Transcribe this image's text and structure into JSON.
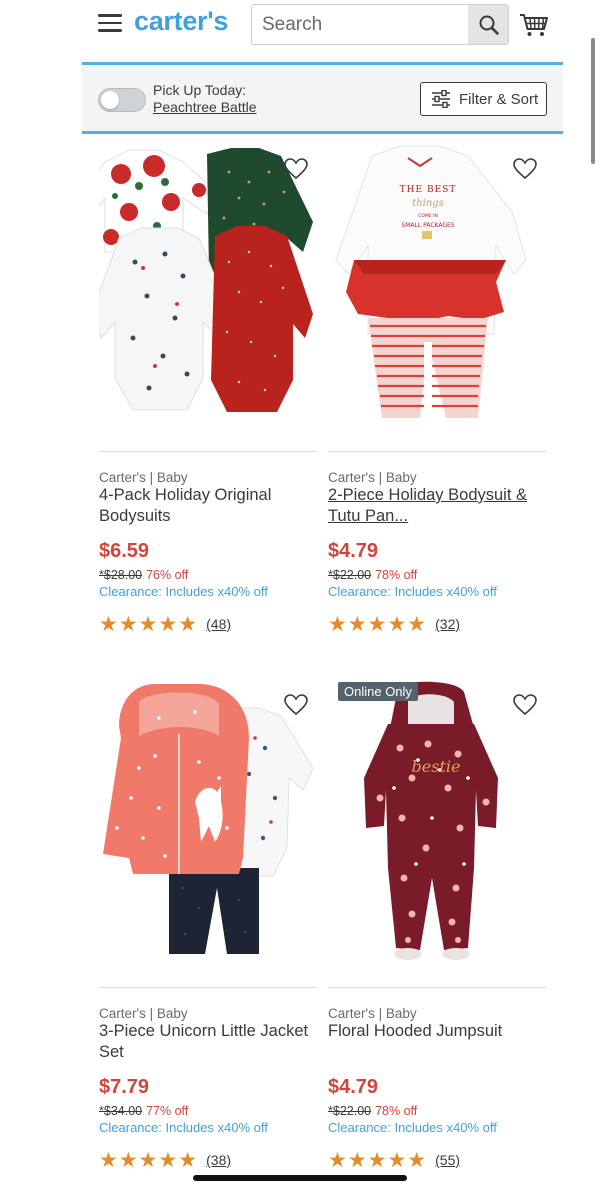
{
  "header": {
    "logo": "carter's",
    "search_placeholder": "Search"
  },
  "filter_bar": {
    "pickup_label": "Pick Up Today:",
    "pickup_store": "Peachtree Battle",
    "filter_label": "Filter & Sort"
  },
  "colors": {
    "brand_blue": "#3fa2dd",
    "sale_red": "#d2453b",
    "star_orange": "#e58b2c"
  },
  "products": [
    {
      "brand": "Carter's | Baby",
      "name": "4-Pack Holiday Original Bodysuits",
      "price": "$6.59",
      "was": "*$28.00",
      "off": "76% off",
      "clearance": "Clearance: Includes x40% off",
      "stars": "★★★★★",
      "rating": 5,
      "reviews": "(48)"
    },
    {
      "brand": "Carter's | Baby",
      "name": "2-Piece Holiday Bodysuit & Tutu Pan...",
      "price": "$4.79",
      "was": "*$22.00",
      "off": "78% off",
      "clearance": "Clearance: Includes x40% off",
      "stars": "★★★★★",
      "rating": 5,
      "reviews": "(32)"
    },
    {
      "brand": "Carter's | Baby",
      "name": "3-Piece Unicorn Little Jacket Set",
      "price": "$7.79",
      "was": "*$34.00",
      "off": "77% off",
      "clearance": "Clearance: Includes x40% off",
      "stars": "★★★★★",
      "rating": 5,
      "reviews": "(38)"
    },
    {
      "badge": "Online Only",
      "brand": "Carter's | Baby",
      "name": "Floral Hooded Jumpsuit",
      "price": "$4.79",
      "was": "*$22.00",
      "off": "78% off",
      "clearance": "Clearance: Includes x40% off",
      "stars": "★★★★★",
      "rating": 5,
      "reviews": "(55)"
    }
  ]
}
